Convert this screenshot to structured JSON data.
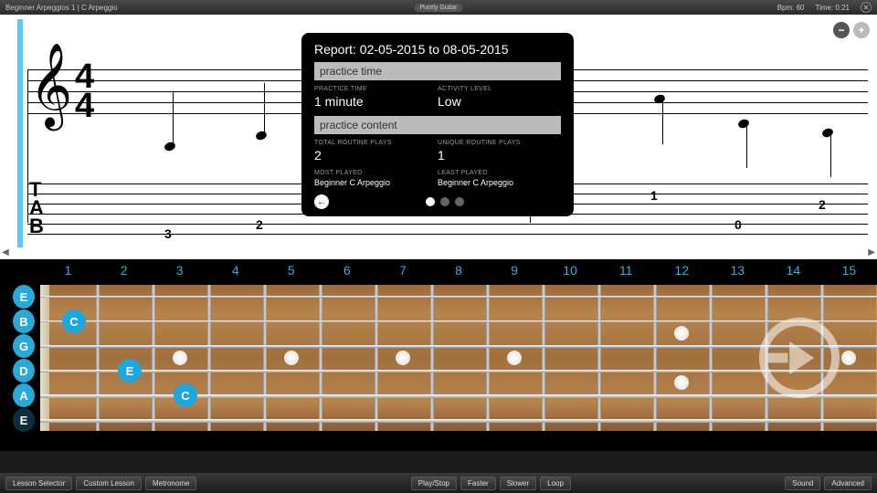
{
  "topbar": {
    "title": "Beginner Arpeggios 1 | C Arpeggio",
    "brand": "Purely Guitar",
    "bpm_label": "Bpm: 60",
    "time_label": "Time: 0:21"
  },
  "zoom": {
    "out": "−",
    "in": "+"
  },
  "timesig": {
    "top": "4",
    "bottom": "4"
  },
  "tab_label": {
    "t": "T",
    "a": "A",
    "b": "B"
  },
  "tab_notes": [
    "3",
    "2",
    "1",
    "2",
    "0"
  ],
  "report": {
    "title": "Report:  02-05-2015  to  08-05-2015",
    "sec1": "practice time",
    "sec2": "practice content",
    "r1": {
      "l1": "PRACTICE TIME",
      "v1": "1 minute",
      "l2": "ACTIVITY LEVEL",
      "v2": "Low"
    },
    "r2": {
      "l1": "TOTAL ROUTINE PLAYS",
      "v1": "2",
      "l2": "UNIQUE ROUTINE PLAYS",
      "v2": "1"
    },
    "r3": {
      "l1": "MOST PLAYED",
      "v1": "Beginner C Arpeggio",
      "l2": "LEAST PLAYED",
      "v2": "Beginner C Arpeggio"
    }
  },
  "fret_numbers": [
    "1",
    "2",
    "3",
    "4",
    "5",
    "6",
    "7",
    "8",
    "9",
    "10",
    "11",
    "12",
    "13",
    "14",
    "15"
  ],
  "strings": [
    "E",
    "B",
    "G",
    "D",
    "A",
    "E"
  ],
  "fingers": [
    {
      "label": "C",
      "fret": 1,
      "string": 1
    },
    {
      "label": "E",
      "fret": 2,
      "string": 3
    },
    {
      "label": "C",
      "fret": 3,
      "string": 4
    }
  ],
  "bottom": {
    "lesson_selector": "Lesson Selector",
    "custom_lesson": "Custom Lesson",
    "metronome": "Metronome",
    "playstop": "Play/Stop",
    "faster": "Faster",
    "slower": "Slower",
    "loop": "Loop",
    "sound": "Sound",
    "advanced": "Advanced"
  }
}
